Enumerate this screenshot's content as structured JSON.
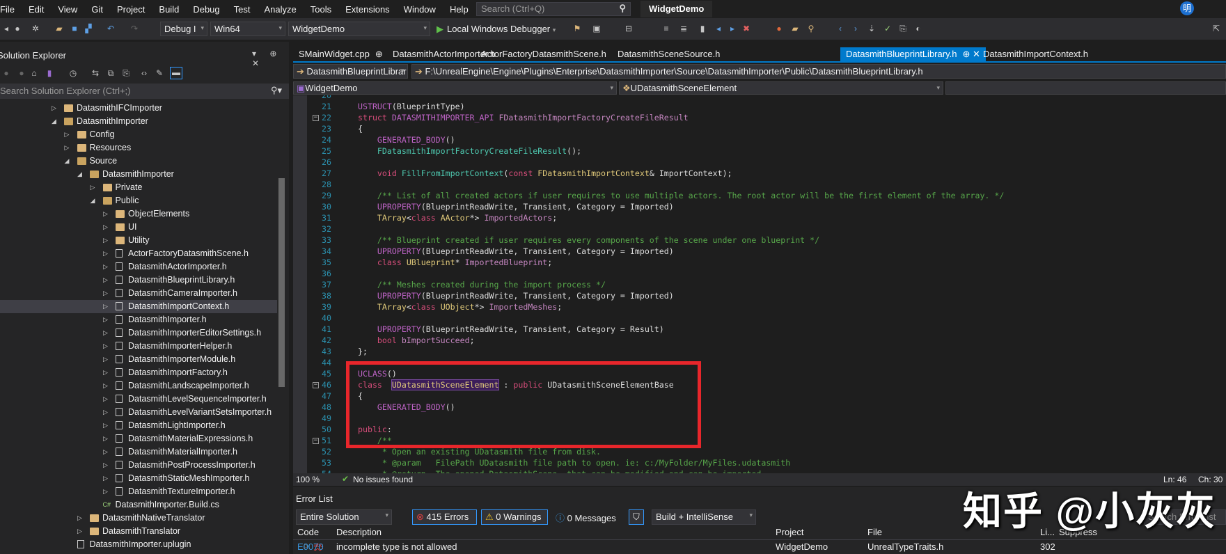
{
  "menu": [
    "File",
    "Edit",
    "View",
    "Git",
    "Project",
    "Build",
    "Debug",
    "Test",
    "Analyze",
    "Tools",
    "Extensions",
    "Window",
    "Help"
  ],
  "search_placeholder": "Search (Ctrl+Q)",
  "app_title": "WidgetDemo",
  "avatar": "明",
  "toolbar": {
    "config": "Debug I",
    "platform": "Win64",
    "project": "WidgetDemo",
    "debugger": "Local Windows Debugger"
  },
  "solution_explorer": {
    "title": "Solution Explorer",
    "search_placeholder": "Search Solution Explorer (Ctrl+;)",
    "tree": [
      {
        "label": "DatasmithIFCImporter",
        "level": 0,
        "icon": "folder",
        "arrow": "right"
      },
      {
        "label": "DatasmithImporter",
        "level": 0,
        "icon": "folder",
        "arrow": "down"
      },
      {
        "label": "Config",
        "level": 1,
        "icon": "folder",
        "arrow": "right"
      },
      {
        "label": "Resources",
        "level": 1,
        "icon": "folder",
        "arrow": "right"
      },
      {
        "label": "Source",
        "level": 1,
        "icon": "folder",
        "arrow": "down"
      },
      {
        "label": "DatasmithImporter",
        "level": 2,
        "icon": "folder",
        "arrow": "down"
      },
      {
        "label": "Private",
        "level": 3,
        "icon": "folder",
        "arrow": "right"
      },
      {
        "label": "Public",
        "level": 3,
        "icon": "folder",
        "arrow": "down"
      },
      {
        "label": "ObjectElements",
        "level": 4,
        "icon": "folder",
        "arrow": "right"
      },
      {
        "label": "UI",
        "level": 4,
        "icon": "folder",
        "arrow": "right"
      },
      {
        "label": "Utility",
        "level": 4,
        "icon": "folder",
        "arrow": "right"
      },
      {
        "label": "ActorFactoryDatasmithScene.h",
        "level": 4,
        "icon": "file",
        "arrow": "right"
      },
      {
        "label": "DatasmithActorImporter.h",
        "level": 4,
        "icon": "file",
        "arrow": "right"
      },
      {
        "label": "DatasmithBlueprintLibrary.h",
        "level": 4,
        "icon": "file",
        "arrow": "right"
      },
      {
        "label": "DatasmithCameraImporter.h",
        "level": 4,
        "icon": "file",
        "arrow": "right"
      },
      {
        "label": "DatasmithImportContext.h",
        "level": 4,
        "icon": "file",
        "arrow": "right",
        "selected": true
      },
      {
        "label": "DatasmithImporter.h",
        "level": 4,
        "icon": "file",
        "arrow": "right"
      },
      {
        "label": "DatasmithImporterEditorSettings.h",
        "level": 4,
        "icon": "file",
        "arrow": "right"
      },
      {
        "label": "DatasmithImporterHelper.h",
        "level": 4,
        "icon": "file",
        "arrow": "right"
      },
      {
        "label": "DatasmithImporterModule.h",
        "level": 4,
        "icon": "file",
        "arrow": "right"
      },
      {
        "label": "DatasmithImportFactory.h",
        "level": 4,
        "icon": "file",
        "arrow": "right"
      },
      {
        "label": "DatasmithLandscapeImporter.h",
        "level": 4,
        "icon": "file",
        "arrow": "right"
      },
      {
        "label": "DatasmithLevelSequenceImporter.h",
        "level": 4,
        "icon": "file",
        "arrow": "right"
      },
      {
        "label": "DatasmithLevelVariantSetsImporter.h",
        "level": 4,
        "icon": "file",
        "arrow": "right"
      },
      {
        "label": "DatasmithLightImporter.h",
        "level": 4,
        "icon": "file",
        "arrow": "right"
      },
      {
        "label": "DatasmithMaterialExpressions.h",
        "level": 4,
        "icon": "file",
        "arrow": "right"
      },
      {
        "label": "DatasmithMaterialImporter.h",
        "level": 4,
        "icon": "file",
        "arrow": "right"
      },
      {
        "label": "DatasmithPostProcessImporter.h",
        "level": 4,
        "icon": "file",
        "arrow": "right"
      },
      {
        "label": "DatasmithStaticMeshImporter.h",
        "level": 4,
        "icon": "file",
        "arrow": "right"
      },
      {
        "label": "DatasmithTextureImporter.h",
        "level": 4,
        "icon": "file",
        "arrow": "right"
      },
      {
        "label": "DatasmithImporter.Build.cs",
        "level": 3,
        "icon": "cs",
        "arrow": ""
      },
      {
        "label": "DatasmithNativeTranslator",
        "level": 2,
        "icon": "folder",
        "arrow": "right"
      },
      {
        "label": "DatasmithTranslator",
        "level": 2,
        "icon": "folder",
        "arrow": "right"
      },
      {
        "label": "DatasmithImporter.uplugin",
        "level": 1,
        "icon": "file",
        "arrow": ""
      }
    ]
  },
  "tabs": [
    {
      "label": "SMainWidget.cpp",
      "pin": "⊕"
    },
    {
      "label": "DatasmithActorImporter.h"
    },
    {
      "label": "ActorFactoryDatasmithScene.h"
    },
    {
      "label": "DatasmithSceneSource.h"
    },
    {
      "label": "DatasmithBlueprintLibrary.h",
      "active": true,
      "pin": "⊕ ✕"
    },
    {
      "label": "DatasmithImportContext.h"
    }
  ],
  "nav": {
    "file": "DatasmithBlueprintLibrar",
    "path": "F:\\UnrealEngine\\Engine\\Plugins\\Enterprise\\DatasmithImporter\\Source\\DatasmithImporter\\Public\\DatasmithBlueprintLibrary.h",
    "project": "WidgetDemo",
    "scope": "UDatasmithSceneElement"
  },
  "code": [
    {
      "n": "20",
      "t": []
    },
    {
      "n": "21",
      "t": [
        [
          "USTRUCT",
          "m"
        ],
        [
          "(BlueprintType)",
          "p"
        ]
      ]
    },
    {
      "n": "22",
      "fold": true,
      "t": [
        [
          "struct ",
          "k"
        ],
        [
          "DATASMITHIMPORTER_API ",
          "m"
        ],
        [
          "FDatasmithImportFactoryCreateFileResult",
          "v"
        ]
      ]
    },
    {
      "n": "23",
      "t": [
        [
          "{",
          "p"
        ]
      ]
    },
    {
      "n": "24",
      "t": [
        [
          "    GENERATED_BODY",
          "m"
        ],
        [
          "()",
          "p"
        ]
      ]
    },
    {
      "n": "25",
      "t": [
        [
          "    FDatasmithImportFactoryCreateFileResult",
          "f"
        ],
        [
          "();",
          "p"
        ]
      ]
    },
    {
      "n": "26",
      "t": []
    },
    {
      "n": "27",
      "t": [
        [
          "    void ",
          "k"
        ],
        [
          "FillFromImportContext",
          "f"
        ],
        [
          "(",
          "p"
        ],
        [
          "const ",
          "k"
        ],
        [
          "FDatasmithImportContext",
          "ty"
        ],
        [
          "& ",
          "p"
        ],
        [
          "ImportContext",
          "p"
        ],
        [
          ");",
          "p"
        ]
      ]
    },
    {
      "n": "28",
      "t": []
    },
    {
      "n": "29",
      "t": [
        [
          "    /** List of all created actors if user requires to use multiple actors. The root actor will be the first element of the array. */",
          "c"
        ]
      ]
    },
    {
      "n": "30",
      "t": [
        [
          "    UPROPERTY",
          "m"
        ],
        [
          "(BlueprintReadWrite, Transient, Category = Imported)",
          "p"
        ]
      ]
    },
    {
      "n": "31",
      "t": [
        [
          "    TArray",
          "ty"
        ],
        [
          "<",
          "p"
        ],
        [
          "class ",
          "k"
        ],
        [
          "AActor",
          "ty"
        ],
        [
          "*> ",
          "p"
        ],
        [
          "ImportedActors",
          "v"
        ],
        [
          ";",
          "p"
        ]
      ]
    },
    {
      "n": "32",
      "t": []
    },
    {
      "n": "33",
      "t": [
        [
          "    /** Blueprint created if user requires every components of the scene under one blueprint */",
          "c"
        ]
      ]
    },
    {
      "n": "34",
      "t": [
        [
          "    UPROPERTY",
          "m"
        ],
        [
          "(BlueprintReadWrite, Transient, Category = Imported)",
          "p"
        ]
      ]
    },
    {
      "n": "35",
      "t": [
        [
          "    class ",
          "k"
        ],
        [
          "UBlueprint",
          "ty"
        ],
        [
          "* ",
          "p"
        ],
        [
          "ImportedBlueprint",
          "v"
        ],
        [
          ";",
          "p"
        ]
      ]
    },
    {
      "n": "36",
      "t": []
    },
    {
      "n": "37",
      "t": [
        [
          "    /** Meshes created during the import process */",
          "c"
        ]
      ]
    },
    {
      "n": "38",
      "t": [
        [
          "    UPROPERTY",
          "m"
        ],
        [
          "(BlueprintReadWrite, Transient, Category = Imported)",
          "p"
        ]
      ]
    },
    {
      "n": "39",
      "t": [
        [
          "    TArray",
          "ty"
        ],
        [
          "<",
          "p"
        ],
        [
          "class ",
          "k"
        ],
        [
          "UObject",
          "ty"
        ],
        [
          "*> ",
          "p"
        ],
        [
          "ImportedMeshes",
          "v"
        ],
        [
          ";",
          "p"
        ]
      ]
    },
    {
      "n": "40",
      "t": []
    },
    {
      "n": "41",
      "t": [
        [
          "    UPROPERTY",
          "m"
        ],
        [
          "(BlueprintReadWrite, Transient, Category = Result)",
          "p"
        ]
      ]
    },
    {
      "n": "42",
      "t": [
        [
          "    bool ",
          "k"
        ],
        [
          "bImportSucceed",
          "v"
        ],
        [
          ";",
          "p"
        ]
      ]
    },
    {
      "n": "43",
      "t": [
        [
          "};",
          "p"
        ]
      ]
    },
    {
      "n": "44",
      "t": []
    },
    {
      "n": "45",
      "t": [
        [
          "UCLASS",
          "m"
        ],
        [
          "()",
          "p"
        ]
      ]
    },
    {
      "n": "46",
      "fold": true,
      "t": [
        [
          "class ",
          "k"
        ],
        [
          " ",
          "p"
        ],
        [
          "UDatasmithSceneElement",
          "hl"
        ],
        [
          " : ",
          "p"
        ],
        [
          "public ",
          "k"
        ],
        [
          "UDatasmithSceneElementBase",
          "p"
        ]
      ]
    },
    {
      "n": "47",
      "t": [
        [
          "{",
          "p"
        ]
      ]
    },
    {
      "n": "48",
      "t": [
        [
          "    GENERATED_BODY",
          "m"
        ],
        [
          "()",
          "p"
        ]
      ]
    },
    {
      "n": "49",
      "t": []
    },
    {
      "n": "50",
      "t": [
        [
          "public",
          "k"
        ],
        [
          ":",
          "p"
        ]
      ]
    },
    {
      "n": "51",
      "fold": true,
      "t": [
        [
          "    /**",
          "c"
        ]
      ]
    },
    {
      "n": "52",
      "t": [
        [
          "     * Open an existing UDatasmith file from disk.",
          "c"
        ]
      ]
    },
    {
      "n": "53",
      "t": [
        [
          "     * @param   FilePath UDatasmith file path to open. ie: c:/MyFolder/MyFiles.udatasmith",
          "c"
        ]
      ]
    },
    {
      "n": "54",
      "t": [
        [
          "     * @return  The opened DatasmithScene, that can be modified and can be imported",
          "c"
        ]
      ]
    }
  ],
  "editor_status": {
    "zoom": "100 %",
    "issues": "No issues found",
    "ln": "Ln: 46",
    "ch": "Ch: 30"
  },
  "error_list": {
    "title": "Error List",
    "scope": "Entire Solution",
    "errors": "415 Errors",
    "warnings": "0 Warnings",
    "messages": "0 Messages",
    "source": "Build + IntelliSense",
    "search_placeholder": "Search Error List",
    "columns": [
      "Code",
      "Description",
      "Project",
      "File",
      "Li...",
      "Suppress"
    ],
    "rows": [
      {
        "code": "E0070",
        "description": "incomplete type is not allowed",
        "project": "WidgetDemo",
        "file": "UnrealTypeTraits.h",
        "line": "302"
      }
    ]
  },
  "watermark": "知乎 @小灰灰"
}
